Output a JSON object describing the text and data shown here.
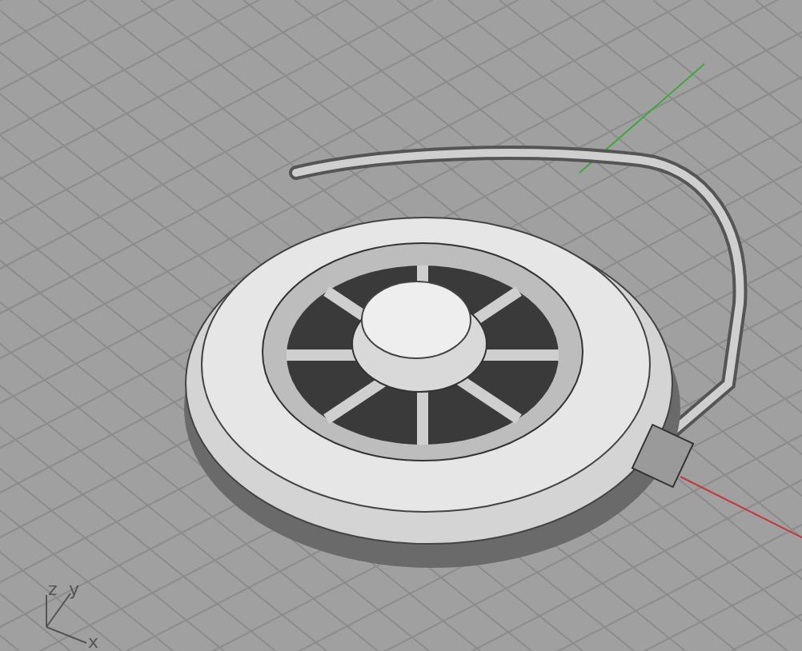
{
  "viewport": {
    "axis_labels": [
      "z",
      "y",
      "x"
    ]
  }
}
